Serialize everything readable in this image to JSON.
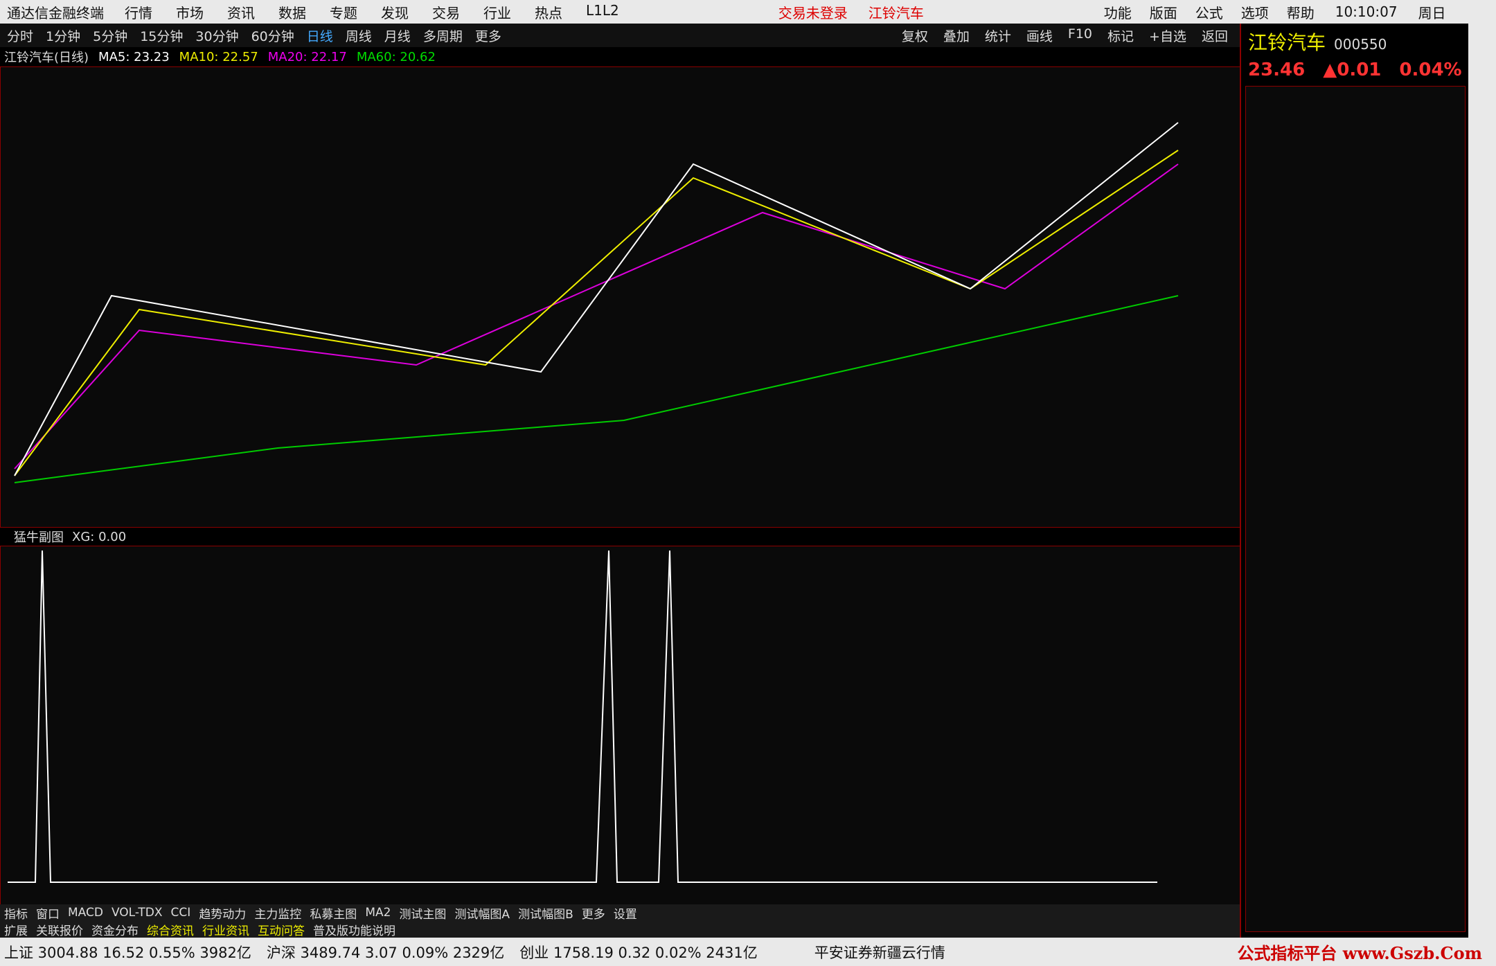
{
  "titlebar": {
    "app": "通达信金融终端",
    "menu": [
      "行情",
      "市场",
      "资讯",
      "数据",
      "专题",
      "发现",
      "交易",
      "行业",
      "热点",
      "L1L2"
    ],
    "notice": "交易未登录",
    "stock": "江铃汽车",
    "right_menu": [
      "功能",
      "版面",
      "公式",
      "选项",
      "帮助"
    ],
    "time": "10:10:07",
    "weekday": "周日"
  },
  "toolbar": {
    "periods": [
      "分时",
      "1分钟",
      "5分钟",
      "15分钟",
      "30分钟",
      "60分钟",
      "日线",
      "周线",
      "月线",
      "多周期",
      "更多"
    ],
    "tools": [
      "复权",
      "叠加",
      "统计",
      "画线",
      "F10",
      "标记",
      "+自选",
      "返回"
    ]
  },
  "infobar": {
    "title": "江铃汽车(日线)",
    "ma": [
      "MA5: 23.23",
      "MA10: 22.57",
      "MA20: 22.17",
      "MA60: 20.62"
    ]
  },
  "quote": {
    "name": "江铃汽车",
    "code": "000550",
    "price": "23.46",
    "change": "▲0.01",
    "pct": "0.04%"
  },
  "subchart": {
    "title": "猛牛副图",
    "xg": "XG: 0.00"
  },
  "tabs": [
    "指标",
    "窗口",
    "MACD",
    "VOL-TDX",
    "CCI",
    "趋势动力",
    "主力监控",
    "私募主图",
    "MA2",
    "测试主图",
    "测试幅图A",
    "测试幅图B",
    "更多",
    "设置"
  ],
  "tabs2": [
    "扩展",
    "关联报价",
    "资金分布",
    "综合资讯",
    "行业资讯",
    "互动问答",
    "普及版功能说明"
  ],
  "status": {
    "indices": [
      "上证 3004.88 16.52 0.55% 3982亿",
      "沪深 3489.74 3.07 0.09% 2329亿",
      "创业 1758.19 0.32 0.02% 2431亿"
    ],
    "broker": "平安证券新疆云行情"
  },
  "logo": "公式指标平台 www.Gszb.Com"
}
